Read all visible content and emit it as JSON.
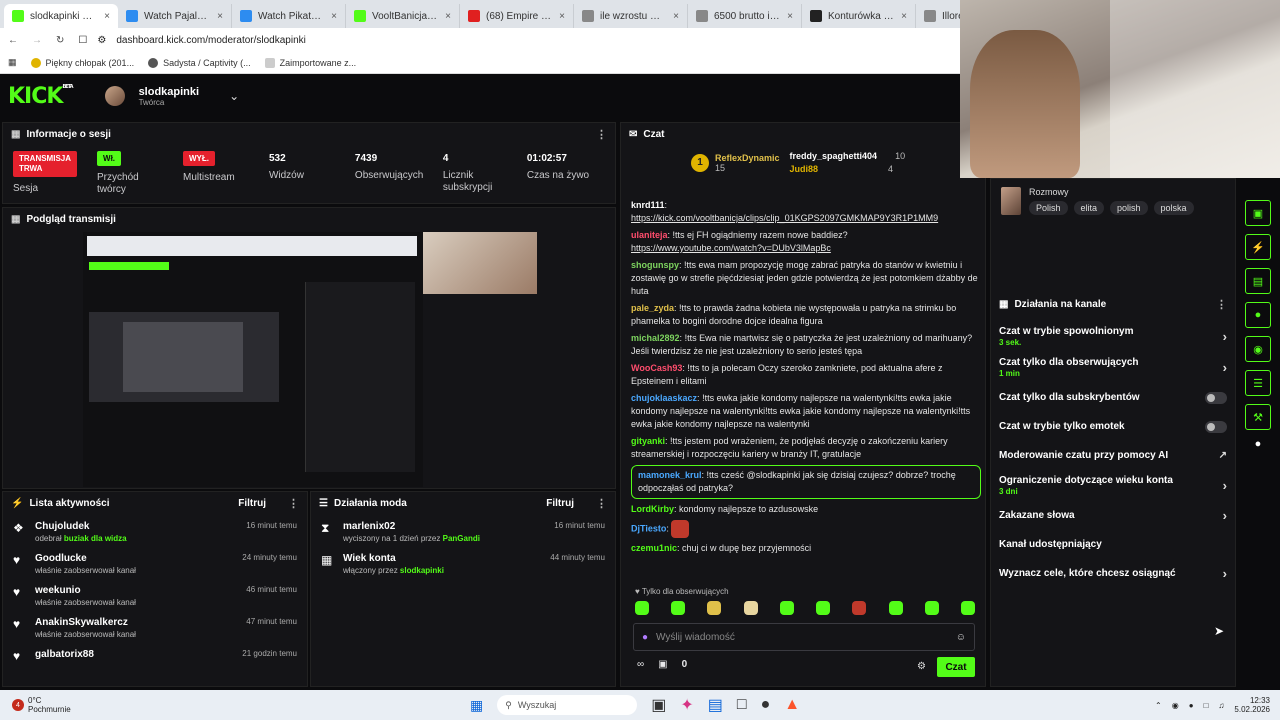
{
  "browser": {
    "tabs": [
      {
        "label": "slodkapinki Stre",
        "color": "#53fc18",
        "icon": "kick-icon"
      },
      {
        "label": "Watch Pajalock | Strea",
        "color": "#2d8cf0",
        "icon": "globe-icon"
      },
      {
        "label": "Watch Pikatne wakacje",
        "color": "#2d8cf0",
        "icon": "globe-icon"
      },
      {
        "label": "VooltBanicja Stream -",
        "color": "#53fc18",
        "icon": "kick-icon"
      },
      {
        "label": "(68) Empire Of The Su",
        "color": "#e02020",
        "icon": "youtube-icon"
      },
      {
        "label": "ile wzrostu ma wysoko",
        "color": "#888888",
        "icon": "search-icon"
      },
      {
        "label": "6500 brutto ile to netto",
        "color": "#888888",
        "icon": "search-icon"
      },
      {
        "label": "Konturówka Charlotte",
        "color": "#222222",
        "icon": "page-icon"
      },
      {
        "label": "Illoret d",
        "color": "#888888",
        "icon": "search-icon"
      }
    ],
    "url": "dashboard.kick.com/moderator/slodkapinki",
    "bookmarks": [
      "Piękny chłopak (201...",
      "Sadysta / Captivity (...",
      "Zaimportowane z..."
    ]
  },
  "header": {
    "logo": "KICK",
    "logo_tag": "BETA",
    "channel": "slodkapinki",
    "role": "Twórca"
  },
  "session": {
    "title": "Informacje o sesji",
    "status_badge": "TRANSMISJA TRWA",
    "status_label": "Sesja",
    "przychod_badge": "Wł.",
    "przychod_label": "Przychód twórcy",
    "multistream_badge": "WYŁ.",
    "multistream_label": "Multistream",
    "viewers": "532",
    "viewers_label": "Widzów",
    "followers": "7439",
    "followers_label": "Obserwujących",
    "subs": "4",
    "subs_label": "Licznik subskrypcji",
    "uptime": "01:02:57",
    "uptime_label": "Czas na żywo"
  },
  "preview": {
    "title": "Podgląd transmisji"
  },
  "activity": {
    "title": "Lista aktywności",
    "filter": "Filtruj",
    "items": [
      {
        "name": "Chujoludek",
        "pre": "odebrał ",
        "hl": "buziak dla widza",
        "time": "16 minut temu",
        "icon": "gift-icon"
      },
      {
        "name": "Goodlucke",
        "pre": "właśnie zaobserwował kanał",
        "hl": "",
        "time": "24 minuty temu",
        "icon": "heart-icon"
      },
      {
        "name": "weekunio",
        "pre": "właśnie zaobserwował kanał",
        "hl": "",
        "time": "46 minut temu",
        "icon": "heart-icon"
      },
      {
        "name": "AnakinSkywalkercz",
        "pre": "właśnie zaobserwował kanał",
        "hl": "",
        "time": "47 minut temu",
        "icon": "heart-icon"
      },
      {
        "name": "galbatorix88",
        "pre": "",
        "hl": "",
        "time": "21 godzin temu",
        "icon": "heart-icon"
      }
    ]
  },
  "modactions": {
    "title": "Działania moda",
    "filter": "Filtruj",
    "items": [
      {
        "name": "marlenix02",
        "pre": "wyciszony na 1 dzień przez ",
        "hl": "PanGandi",
        "time": "16 minut temu",
        "icon": "hourglass-icon"
      },
      {
        "name": "Wiek konta",
        "pre": "włączony przez ",
        "hl": "slodkapinki",
        "time": "44 minuty temu",
        "icon": "calendar-icon"
      }
    ]
  },
  "chat": {
    "title": "Czat",
    "top": [
      {
        "name": "ReflexDynamic",
        "count": "15",
        "rank": "1"
      },
      {
        "name": "freddy_spaghetti404",
        "count": "10"
      },
      {
        "name": "Judi88",
        "count": "4"
      }
    ],
    "messages": [
      {
        "user": "knrd111",
        "color": "#ffffff",
        "text": "",
        "link": "https://kick.com/vooltbanicja/clips/clip_01KGPS2097GMKMAP9Y3R1P1MM9"
      },
      {
        "user": "ulaniteja",
        "color": "#ff4d6d",
        "text": "!tts ej FH ogiądniemy razem nowe baddiez?",
        "link": "https://www.youtube.com/watch?v=DUbV3lMapBc"
      },
      {
        "user": "shogunspy",
        "color": "#7dd35f",
        "text": "!tts ewa mam propozycję mogę zabrać patryka do stanów w kwietniu i zostawię go w strefie pięćdziesiąt jeden gdzie potwierdzą że jest potomkiem dżabby de huta",
        "link": ""
      },
      {
        "user": "pale_zyda",
        "color": "#e0c04a",
        "text": "!tts to prawda żadna kobieta nie występowała u patryka na strimku bo phamelka to bogini dorodne dojce idealna figura",
        "link": ""
      },
      {
        "user": "michal2892",
        "color": "#7dd35f",
        "text": "!tts Ewa nie martwisz się o patryczka że jest uzależniony od marihuany? Jeśli twierdzisz że nie jest uzależniony to serio jesteś tępa",
        "link": ""
      },
      {
        "user": "WooCash93",
        "color": "#ff4d6d",
        "text": "!tts to ja polecam Oczy szeroko zamkniete, pod aktualna afere z Epsteinem i elitami",
        "link": ""
      },
      {
        "user": "chujoklaaskacz",
        "color": "#4aa8ff",
        "text": "!tts ewka jakie kondomy najlepsze na walentynki!tts ewka jakie kondomy najlepsze na walentynki!tts ewka jakie kondomy najlepsze na walentynki!tts ewka jakie kondomy najlepsze na walentynki",
        "link": ""
      },
      {
        "user": "gityanki",
        "color": "#53fc18",
        "text": "!tts jestem pod wrażeniem, że podjęłaś decyzję o zakończeniu kariery streamerskiej i rozpoczęciu kariery w branży IT, gratulacje",
        "link": ""
      },
      {
        "user": "mamonek_krul",
        "color": "#4aa8ff",
        "text": "!tts cześć @slodkapinki jak się dzisiaj czujesz? dobrze? trochę odpocząłaś od patryka?",
        "link": "",
        "highlight": true
      },
      {
        "user": "LordKirby",
        "color": "#53fc18",
        "text": "kondomy najlepsze to azdusowske",
        "link": ""
      },
      {
        "user": "DjTiesto",
        "color": "#4aa8ff",
        "text": "",
        "link": "",
        "emote": true
      },
      {
        "user": "czemu1nic",
        "color": "#53fc18",
        "text": "chuj ci w dupę bez przyjemności",
        "link": ""
      }
    ],
    "followers_only": "Tylko dla obserwujących",
    "input_placeholder": "Wyślij wiadomość",
    "send": "Czat",
    "count": "0"
  },
  "channel": {
    "category": "Rozmowy",
    "tags": [
      "Polish",
      "elita",
      "polish",
      "polska"
    ],
    "actions_title": "Działania na kanale",
    "options": [
      {
        "label": "Czat w trybie spowolnionym",
        "sub": "3 sek.",
        "ctl": "chevron"
      },
      {
        "label": "Czat tylko dla obserwujących",
        "sub": "1 min",
        "ctl": "chevron"
      },
      {
        "label": "Czat tylko dla subskrybentów",
        "sub": "",
        "ctl": "toggle"
      },
      {
        "label": "Czat w trybie tylko emotek",
        "sub": "",
        "ctl": "toggle"
      },
      {
        "label": "Moderowanie czatu przy pomocy AI",
        "sub": "",
        "ctl": "external"
      },
      {
        "label": "Ograniczenie dotyczące wieku konta",
        "sub": "3 dni",
        "ctl": "chevron"
      },
      {
        "label": "Zakazane słowa",
        "sub": "",
        "ctl": "chevron"
      },
      {
        "label": "Kanał udostępniający",
        "sub": "",
        "ctl": "none"
      },
      {
        "label": "Wyznacz cele, które chcesz osiągnąć",
        "sub": "",
        "ctl": "chevron"
      }
    ]
  },
  "taskbar": {
    "weather": "0°C",
    "weather_desc": "Pochmurnie",
    "search": "Wyszukaj",
    "time": "12:33",
    "date": "5.02.2026",
    "notif": "4"
  }
}
